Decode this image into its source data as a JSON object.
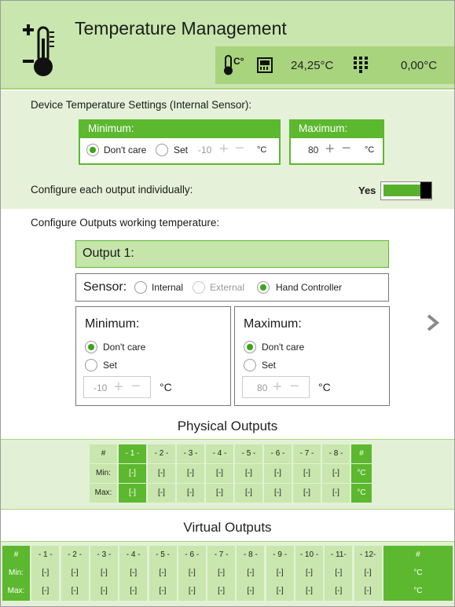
{
  "header": {
    "title": "Temperature Management",
    "internal_temp": "24,25°C",
    "external_temp": "0,00°C"
  },
  "device": {
    "title": "Device Temperature Settings (Internal Sensor):",
    "minimum": {
      "label": "Minimum:",
      "dont_care_label": "Don't care",
      "set_label": "Set",
      "value": "-10",
      "unit": "°C",
      "selected": "dont_care"
    },
    "maximum": {
      "label": "Maximum:",
      "value": "80",
      "unit": "°C"
    },
    "configure_each_label": "Configure each output individually:",
    "configure_each_value": "Yes"
  },
  "outputs_config": {
    "title": "Configure Outputs working temperature:",
    "output_name": "Output 1:",
    "sensor": {
      "label": "Sensor:",
      "options": [
        "Internal",
        "External",
        "Hand Controller"
      ],
      "selected": "Hand Controller"
    },
    "minimum": {
      "label": "Minimum:",
      "dont_care_label": "Don't care",
      "set_label": "Set",
      "value": "-10",
      "unit": "°C"
    },
    "maximum": {
      "label": "Maximum:",
      "dont_care_label": "Don't care",
      "set_label": "Set",
      "value": "80",
      "unit": "°C"
    }
  },
  "physical_outputs": {
    "title": "Physical Outputs",
    "row_labels": [
      "#",
      "Min:",
      "Max:"
    ],
    "columns": [
      "- 1 -",
      "- 2 -",
      "- 3 -",
      "- 4 -",
      "- 5 -",
      "- 6 -",
      "- 7 -",
      "- 8 -"
    ],
    "values": "[-]",
    "end_labels": [
      "#",
      "°C",
      "°C"
    ],
    "selected_column": 0
  },
  "virtual_outputs": {
    "title": "Virtual Outputs",
    "row_labels": [
      "#",
      "Min:",
      "Max:"
    ],
    "columns": [
      "- 1 -",
      "- 2 -",
      "- 3 -",
      "- 4 -",
      "- 5 -",
      "- 6 -",
      "- 7 -",
      "- 8 -",
      "- 9 -",
      "- 10 -",
      "- 11-",
      "- 12-"
    ],
    "values": "[-]",
    "end_labels": [
      "#",
      "°C",
      "°C"
    ]
  },
  "colors": {
    "header_bg": "#c8e6ad",
    "status_bg": "#a9d47e",
    "accent": "#5cb82e",
    "panel_bg": "#e5f2d9"
  }
}
